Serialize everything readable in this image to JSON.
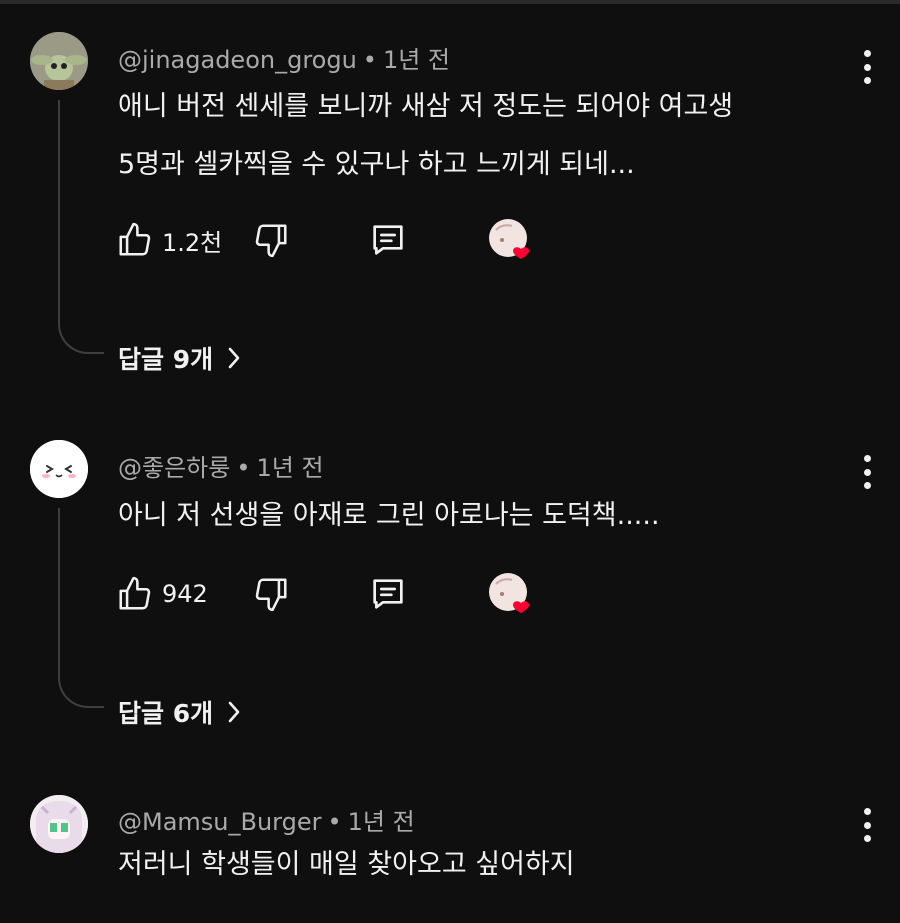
{
  "comments": [
    {
      "author": "@jinagadeon_grogu",
      "time": "1년 전",
      "lines": [
        "애니 버전 센세를 보니까 새삼 저 정도는 되어야 여고생",
        "5명과 셀카찍을 수 있구나 하고 느끼게 되네..."
      ],
      "likes": "1.2천",
      "replies_label": "답글 9개"
    },
    {
      "author": "@좋은하룽",
      "time": "1년 전",
      "lines": [
        "아니 저 선생을 아재로 그린 아로나는 도덕책....."
      ],
      "likes": "942",
      "replies_label": "답글 6개"
    },
    {
      "author": "@Mamsu_Burger",
      "time": "1년 전",
      "lines": [
        "저러니 학생들이 매일 찾아오고 싶어하지"
      ]
    }
  ],
  "separator": "•",
  "colors": {
    "background": "#0f0f0f",
    "text": "#f1f1f1",
    "meta": "#aaaaaa",
    "heart": "#ff0033",
    "thread": "#3f3f3f"
  },
  "icons": [
    "like-icon",
    "dislike-icon",
    "reply-icon",
    "creator-heart-icon",
    "more-vert-icon",
    "chevron-right-icon"
  ]
}
